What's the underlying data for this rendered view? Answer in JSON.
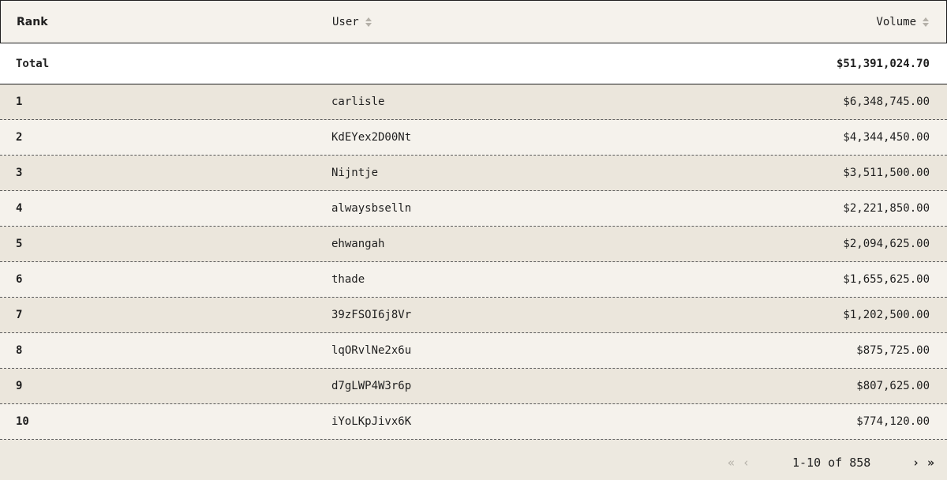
{
  "table": {
    "headers": {
      "rank": "Rank",
      "user": "User",
      "volume": "Volume"
    },
    "total": {
      "label": "Total",
      "volume": "$51,391,024.70"
    },
    "rows": [
      {
        "rank": "1",
        "user": "carlisle",
        "volume": "$6,348,745.00"
      },
      {
        "rank": "2",
        "user": "KdEYex2D00Nt",
        "volume": "$4,344,450.00"
      },
      {
        "rank": "3",
        "user": "Nijntje",
        "volume": "$3,511,500.00"
      },
      {
        "rank": "4",
        "user": "alwaysbselln",
        "volume": "$2,221,850.00"
      },
      {
        "rank": "5",
        "user": "ehwangah",
        "volume": "$2,094,625.00"
      },
      {
        "rank": "6",
        "user": "thade",
        "volume": "$1,655,625.00"
      },
      {
        "rank": "7",
        "user": "39zFSOI6j8Vr",
        "volume": "$1,202,500.00"
      },
      {
        "rank": "8",
        "user": "lqORvlNe2x6u",
        "volume": "$875,725.00"
      },
      {
        "rank": "9",
        "user": "d7gLWP4W3r6p",
        "volume": "$807,625.00"
      },
      {
        "rank": "10",
        "user": "iYoLKpJivx6K",
        "volume": "$774,120.00"
      }
    ]
  },
  "pagination": {
    "first": "«",
    "prev": "‹",
    "range": "1-10 of 858",
    "next": "›",
    "last": "»"
  },
  "icons": {
    "sort": "sort-icon"
  }
}
